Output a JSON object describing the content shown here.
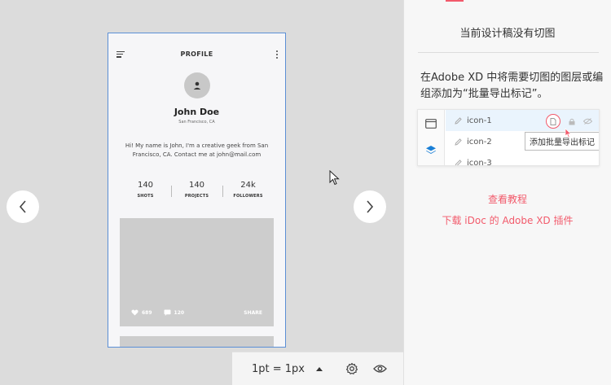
{
  "artboard": {
    "header_title": "PROFILE",
    "user_name": "John Doe",
    "location": "San Francisco, CA",
    "bio": "Hi! My name is John, I'm a creative geek from San Francisco, CA. Contact me at john@mail.com",
    "stats": [
      {
        "value": "140",
        "label": "SHOTS"
      },
      {
        "value": "140",
        "label": "PROJECTS"
      },
      {
        "value": "24k",
        "label": "FOLLOWERS"
      }
    ],
    "post": {
      "likes": "689",
      "comments": "120",
      "share_label": "SHARE"
    }
  },
  "zoom": {
    "label": "1pt = 1px"
  },
  "panel": {
    "title": "当前设计稿没有切图",
    "description": "在Adobe XD 中将需要切图的图层或编组添加为“批量导出标记”。",
    "demo": {
      "rows": [
        "icon-1",
        "icon-2",
        "icon-3"
      ],
      "tooltip": "添加批量导出标记"
    },
    "link_tutorial": "查看教程",
    "link_plugin": "下载 iDoc 的 Adobe XD 插件"
  },
  "colors": {
    "accent": "#f25a6b",
    "artboard_border": "#5c8fd6",
    "canvas_bg": "#dcdcdc",
    "row_highlight": "#eaf4fd",
    "layers_icon": "#1a7fd6"
  },
  "icons": [
    "chevron-left-icon",
    "chevron-right-icon",
    "menu-icon",
    "more-vertical-icon",
    "user-icon",
    "heart-icon",
    "comment-icon",
    "pointer-cursor-icon",
    "caret-up-icon",
    "gear-icon",
    "eye-icon",
    "artboard-icon",
    "layers-icon",
    "pen-icon",
    "export-mark-icon",
    "lock-icon",
    "hidden-eye-icon"
  ]
}
